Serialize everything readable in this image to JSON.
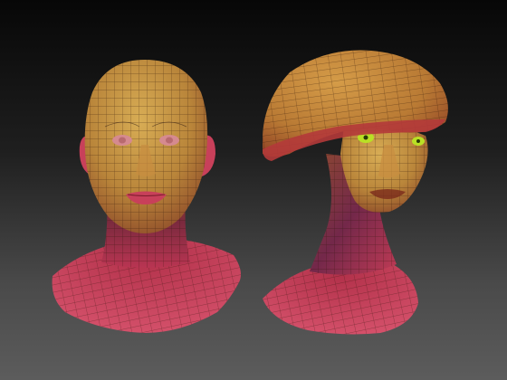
{
  "scene": {
    "background_top": "#070707",
    "background_bottom": "#5c5c5c",
    "models": [
      {
        "name": "human-head-model",
        "palette": [
          "#c79a45",
          "#b8602c",
          "#c43a4c",
          "#d3506c"
        ]
      },
      {
        "name": "mushroom-head-model",
        "palette": [
          "#c58a3a",
          "#b4532a",
          "#c43a4c",
          "#d3506c"
        ],
        "eye_color": "#b9e025"
      }
    ]
  }
}
